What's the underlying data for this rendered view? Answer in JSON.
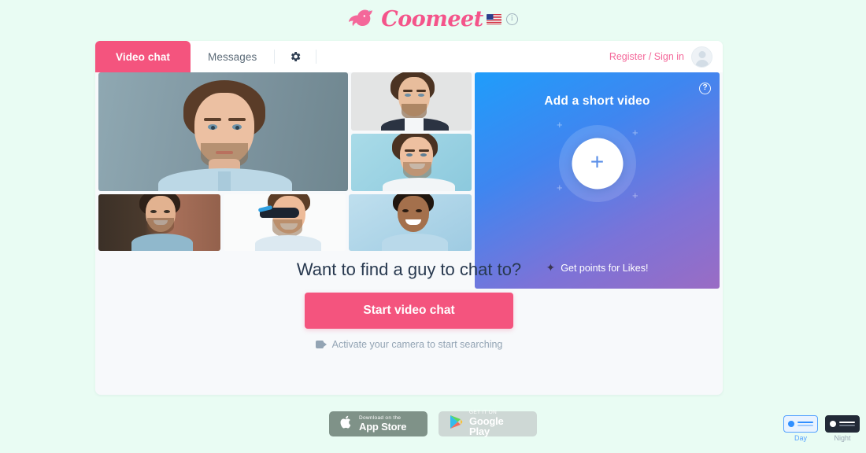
{
  "header": {
    "brand_name": "Coomeet",
    "bird_icon": "bird-icon",
    "flag_icon": "us-flag-icon",
    "flag_alt": "United States",
    "info_icon": "info-icon",
    "info_glyph": "i",
    "brand_color": "#f4548a"
  },
  "tabbar": {
    "tabs": [
      {
        "label": "Video chat",
        "active": true
      },
      {
        "label": "Messages",
        "active": false
      }
    ],
    "gear_icon": "gear-icon",
    "auth_label": "Register / Sign in",
    "auth_color": "#f4689a",
    "avatar_icon": "avatar-icon"
  },
  "gallery": {
    "photos": [
      {
        "name": "photo-main",
        "alt": "Young man in light blue shirt against gray wall"
      },
      {
        "name": "photo-top-right-1",
        "alt": "Man with beard in dark suit on light gray background"
      },
      {
        "name": "photo-top-right-2",
        "alt": "Smiling man in white shirt on light blue background"
      },
      {
        "name": "photo-bottom-1",
        "alt": "Smiling man in front of brick wall"
      },
      {
        "name": "photo-bottom-2",
        "alt": "Man with blue sunglasses on white background"
      },
      {
        "name": "photo-bottom-3",
        "alt": "Smiling man in light blue shirt on blue background"
      }
    ]
  },
  "video_panel": {
    "title": "Add a short video",
    "help_icon": "question-mark-icon",
    "help_glyph": "?",
    "plus_icon": "plus-icon",
    "plus_glyph": "+",
    "footer_text": "Get points for Likes!",
    "footer_icon": "sparkle-icon",
    "footer_glyph": "✦",
    "gradient_from": "#1f9dfb",
    "gradient_to": "#9a6cc4",
    "sparkles": [
      "+",
      "+",
      "+",
      "+"
    ]
  },
  "hero": {
    "title": "Want to find a guy to chat to?",
    "cta_label": "Start video chat",
    "cta_color": "#f4547e",
    "camera_note": "Activate your camera to start searching",
    "camera_icon": "video-camera-icon"
  },
  "stores": {
    "apple": {
      "small": "Download on the",
      "big": "App Store",
      "icon": "apple-logo-icon",
      "glyph": ""
    },
    "google": {
      "small": "GET IT ON",
      "big": "Google Play",
      "icon": "google-play-icon"
    }
  },
  "theme": {
    "day_label": "Day",
    "night_label": "Night",
    "selected": "Day",
    "day_accent": "#55a2ff",
    "night_bg": "#222a37"
  }
}
